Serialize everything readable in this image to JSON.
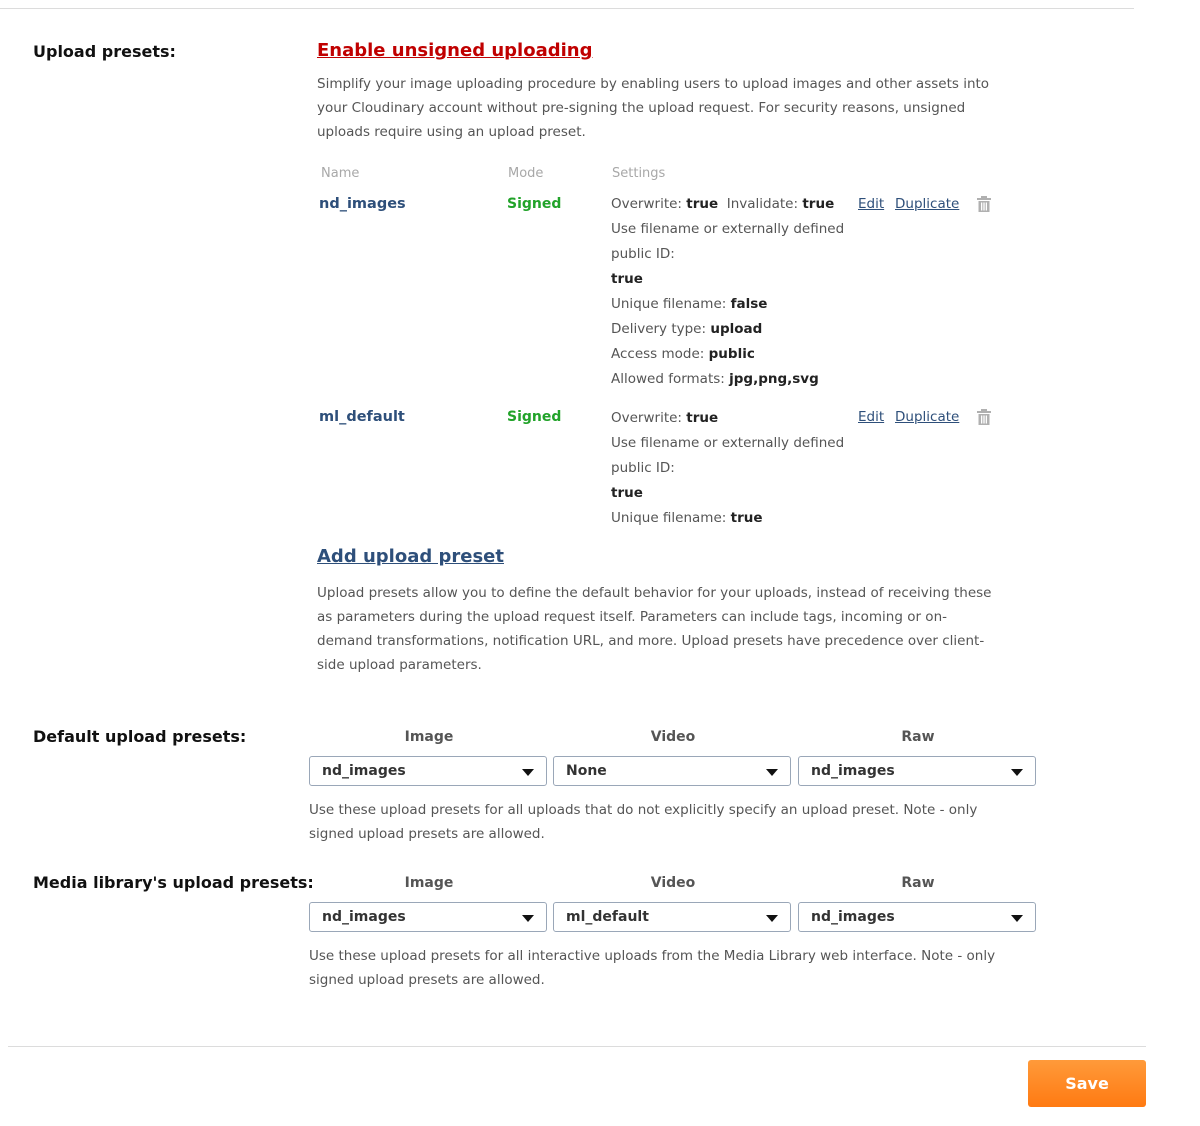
{
  "upload_presets": {
    "label": "Upload presets:",
    "enable_unsigned_link": "Enable unsigned uploading",
    "enable_unsigned_desc": "Simplify your image uploading procedure by enabling users to upload images and other assets into your Cloudinary account without pre-signing the upload request. For security reasons, unsigned uploads require using an upload preset.",
    "columns": {
      "name": "Name",
      "mode": "Mode",
      "settings": "Settings"
    },
    "presets": [
      {
        "name": "nd_images",
        "mode": "Signed",
        "settings": [
          {
            "k": "Overwrite:",
            "v": "true",
            "k2": "Invalidate:",
            "v2": "true"
          },
          {
            "k": "Use filename or externally defined public ID:",
            "v": "true"
          },
          {
            "k": "Unique filename:",
            "v": "false"
          },
          {
            "k": "Delivery type:",
            "v": "upload"
          },
          {
            "k": "Access mode:",
            "v": "public"
          },
          {
            "k": "Allowed formats:",
            "v": "jpg,png,svg"
          }
        ],
        "edit_label": "Edit",
        "duplicate_label": "Duplicate"
      },
      {
        "name": "ml_default",
        "mode": "Signed",
        "settings": [
          {
            "k": "Overwrite:",
            "v": "true"
          },
          {
            "k": "Use filename or externally defined public ID:",
            "v": "true"
          },
          {
            "k": "Unique filename:",
            "v": "true"
          }
        ],
        "edit_label": "Edit",
        "duplicate_label": "Duplicate"
      }
    ],
    "add_link": "Add upload preset",
    "add_desc": "Upload presets allow you to define the default behavior for your uploads, instead of receiving these as parameters during the upload request itself. Parameters can include tags, incoming or on-demand transformations, notification URL, and more. Upload presets have precedence over client-side upload parameters."
  },
  "default_presets": {
    "label": "Default upload presets:",
    "headers": [
      "Image",
      "Video",
      "Raw"
    ],
    "values": [
      "nd_images",
      "None",
      "nd_images"
    ],
    "note": "Use these upload presets for all uploads that do not explicitly specify an upload preset. Note - only signed upload presets are allowed."
  },
  "media_library_presets": {
    "label": "Media library's upload presets:",
    "headers": [
      "Image",
      "Video",
      "Raw"
    ],
    "values": [
      "nd_images",
      "ml_default",
      "nd_images"
    ],
    "note": "Use these upload presets for all interactive uploads from the Media Library web interface. Note - only signed upload presets are allowed."
  },
  "save_label": "Save",
  "colors": {
    "link_red": "#c00000",
    "link_blue": "#2e4f7a",
    "signed_green": "#22a32a",
    "save_orange": "#ff8a22"
  }
}
